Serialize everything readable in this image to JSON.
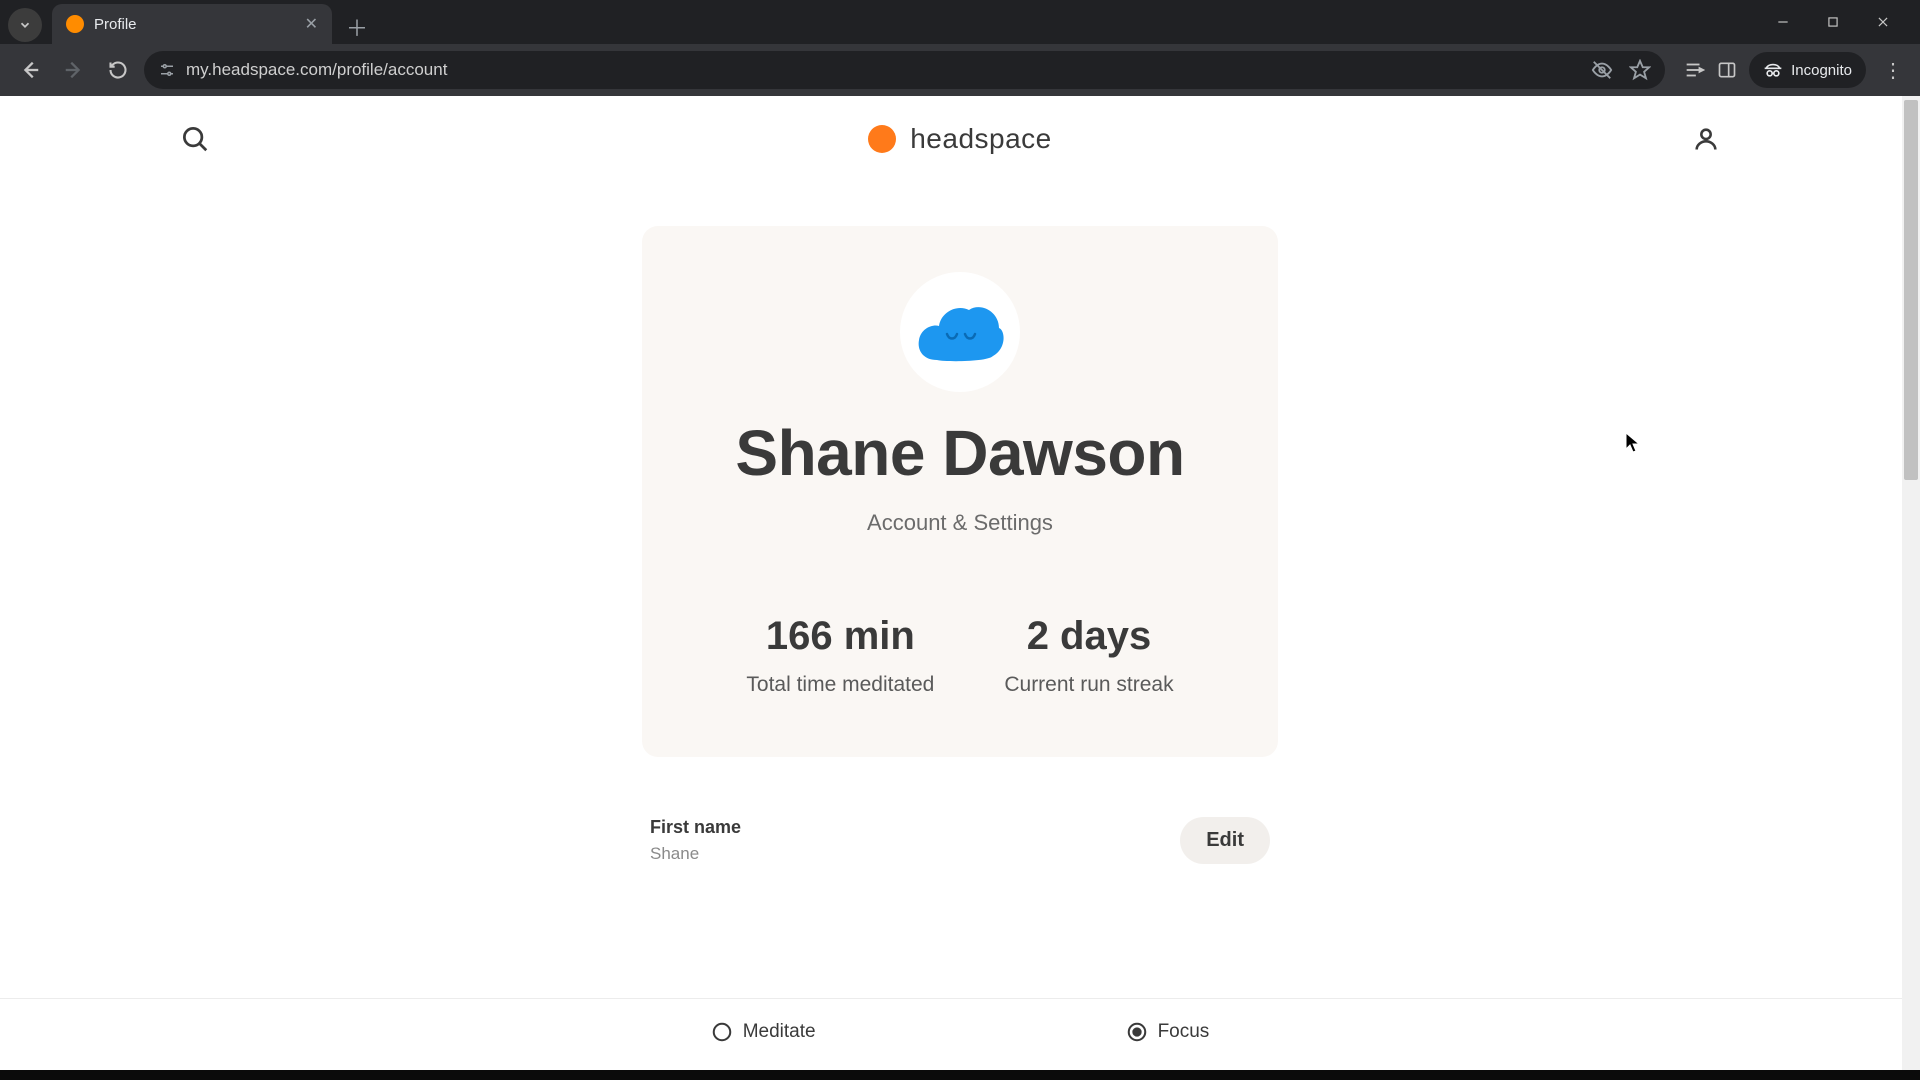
{
  "browser": {
    "tab_title": "Profile",
    "url": "my.headspace.com/profile/account",
    "incognito_label": "Incognito"
  },
  "header": {
    "brand": "headspace"
  },
  "profile": {
    "display_name": "Shane Dawson",
    "subtitle": "Account & Settings",
    "stats": {
      "meditated_value": "166 min",
      "meditated_label": "Total time meditated",
      "streak_value": "2 days",
      "streak_label": "Current run streak"
    }
  },
  "field": {
    "label": "First name",
    "value": "Shane",
    "edit": "Edit"
  },
  "nav": {
    "meditate": "Meditate",
    "focus": "Focus"
  }
}
